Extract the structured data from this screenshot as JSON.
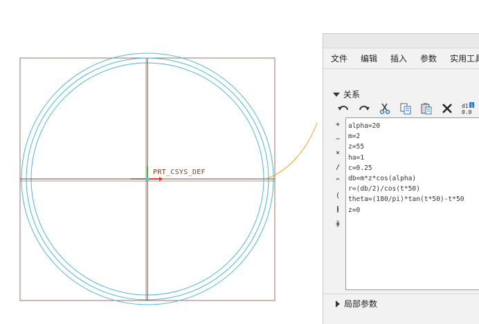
{
  "viewport": {
    "csys_label": "PRT_CSYS_DEF",
    "colors": {
      "frame": "#a0705a",
      "circle": "#4fb5d6",
      "axis": "#6a4a3a",
      "leader": "#f2a020"
    }
  },
  "dialog": {
    "menu": [
      "文件",
      "编辑",
      "插入",
      "参数",
      "实用工具"
    ],
    "section_title": "关系",
    "toolbar": {
      "undo_icon": "undo-icon",
      "redo_icon": "redo-icon",
      "cut_icon": "scissors-icon",
      "copy_icon": "copy-icon",
      "paste_icon": "paste-icon",
      "delete_icon": "delete-x-icon",
      "value_toggle_icon": "d1-value-icon"
    },
    "operators": [
      "+",
      "−",
      "×",
      "/",
      "^",
      "( )",
      "[ ]",
      "="
    ],
    "relations": [
      "alpha=20",
      "m=2",
      "z=55",
      "ha=1",
      "c=0.25",
      "db=m*z*cos(alpha)",
      "r=(db/2)/cos(t*50)",
      "theta=(180/pi)*tan(t*50)-t*50",
      "z=0"
    ],
    "local_params": "局部参数"
  }
}
